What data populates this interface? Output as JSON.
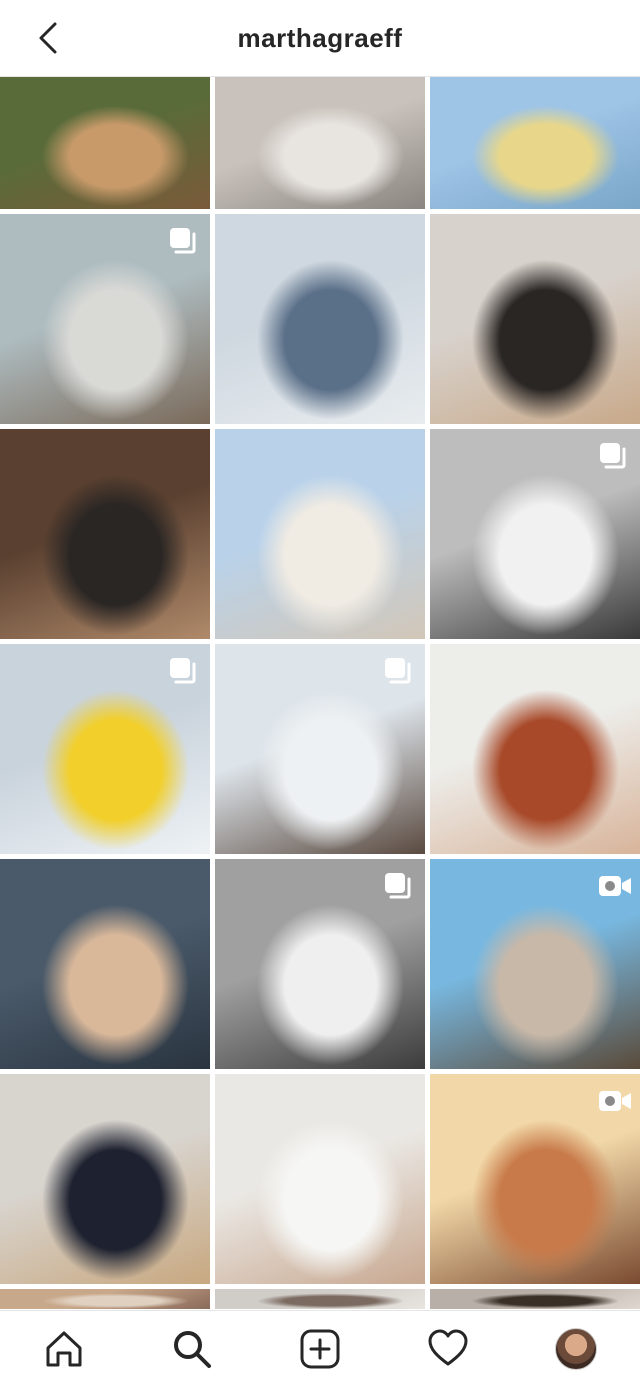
{
  "header": {
    "username": "marthagraeff"
  },
  "grid": {
    "tiles": [
      {
        "badge": "none",
        "colors": [
          "#5a6b3a",
          "#c89a6a",
          "#7a5a3a"
        ]
      },
      {
        "badge": "none",
        "colors": [
          "#c9c2bc",
          "#e8e4e0",
          "#8a8580"
        ]
      },
      {
        "badge": "none",
        "colors": [
          "#9ec4e6",
          "#e8d78a",
          "#7aa6c8"
        ]
      },
      {
        "badge": "carousel",
        "colors": [
          "#aebcc0",
          "#d9d9d6",
          "#7a6a5a"
        ]
      },
      {
        "badge": "none",
        "colors": [
          "#cfd8e0",
          "#5a6f88",
          "#e8ecef"
        ]
      },
      {
        "badge": "none",
        "colors": [
          "#d8d2cc",
          "#2a2624",
          "#c8a98a"
        ]
      },
      {
        "badge": "none",
        "colors": [
          "#5a4030",
          "#2a2624",
          "#b08a6a"
        ]
      },
      {
        "badge": "none",
        "colors": [
          "#b9d2ea",
          "#f0ebe3",
          "#d2c7b8"
        ]
      },
      {
        "badge": "carousel",
        "colors": [
          "#bdbdbd",
          "#f1f1f1",
          "#3a3a3a"
        ]
      },
      {
        "badge": "carousel",
        "colors": [
          "#c9d3dc",
          "#f2cf2a",
          "#eef2f5"
        ]
      },
      {
        "badge": "carousel",
        "colors": [
          "#dde4ea",
          "#eef1f3",
          "#5a4a40"
        ]
      },
      {
        "badge": "none",
        "colors": [
          "#ededea",
          "#a84a2a",
          "#d8b49a"
        ]
      },
      {
        "badge": "none",
        "colors": [
          "#4a5a6a",
          "#d9b89a",
          "#2a3440"
        ]
      },
      {
        "badge": "carousel",
        "colors": [
          "#a0a0a0",
          "#efefef",
          "#3c3c3c"
        ]
      },
      {
        "badge": "video",
        "colors": [
          "#78b8e0",
          "#c8b8a8",
          "#5a4a3a"
        ]
      },
      {
        "badge": "none",
        "colors": [
          "#d8d4ce",
          "#1e2230",
          "#c8a880"
        ]
      },
      {
        "badge": "none",
        "colors": [
          "#eae8e4",
          "#f6f6f4",
          "#c8a890"
        ]
      },
      {
        "badge": "video",
        "colors": [
          "#f2d8a8",
          "#c87a4a",
          "#7a4a30"
        ]
      },
      {
        "badge": "none",
        "colors": [
          "#c8a88a",
          "#e0d0c0",
          "#8a6a5a"
        ]
      },
      {
        "badge": "none",
        "colors": [
          "#d0ccc8",
          "#7a6a60",
          "#e8e4e0"
        ]
      },
      {
        "badge": "none",
        "colors": [
          "#b8b0a8",
          "#3a3028",
          "#e0d8d0"
        ]
      }
    ]
  },
  "nav": {
    "items": [
      "home-icon",
      "search-icon",
      "add-icon",
      "heart-icon",
      "profile-avatar"
    ]
  }
}
